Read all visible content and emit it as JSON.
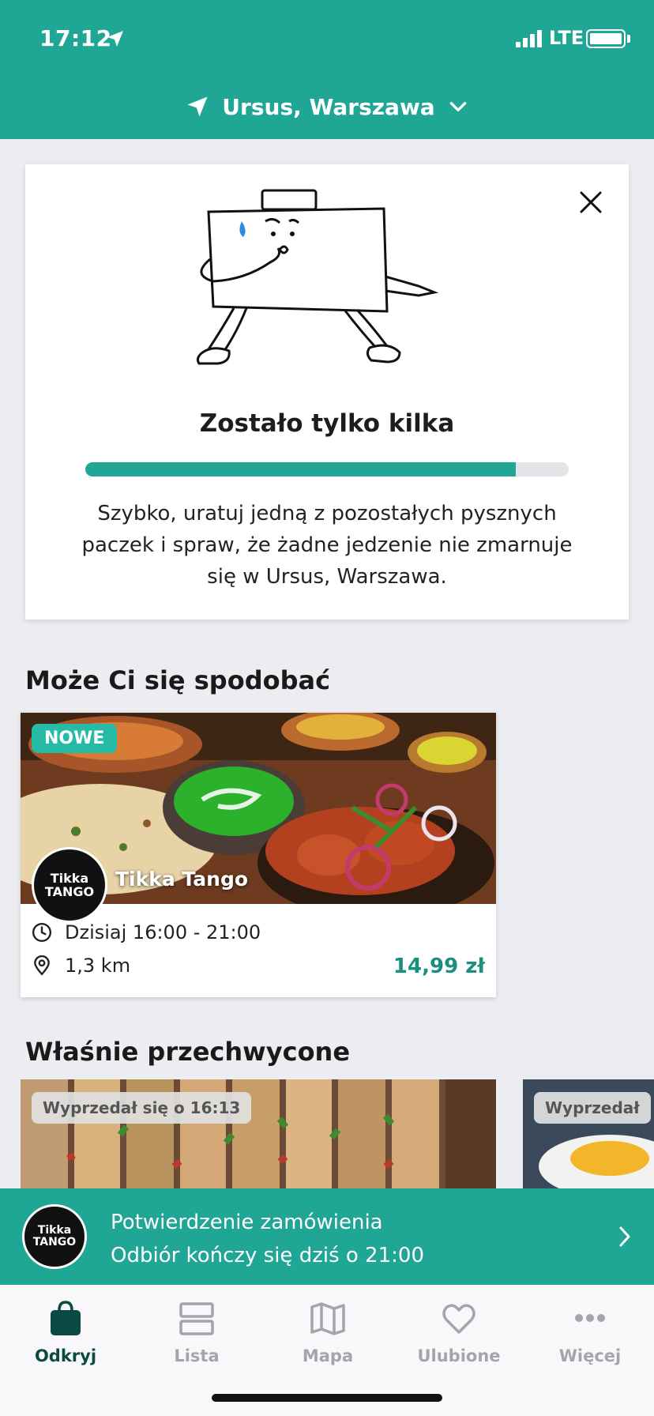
{
  "status_bar": {
    "time": "17:12",
    "network": "LTE"
  },
  "location": {
    "label": "Ursus, Warszawa"
  },
  "promo": {
    "title": "Zostało tylko kilka",
    "progress_percent": 89,
    "description": "Szybko, uratuj jedną z pozostałych pysznych paczek i spraw, że żadne jedzenie nie zmarnuje się w Ursus, Warszawa."
  },
  "recommended": {
    "title": "Może Ci się spodobać",
    "store": {
      "badge": "NOWE",
      "name": "Tikka Tango",
      "logo_text_1": "Tikka",
      "logo_text_2": "TANGO",
      "pickup": "Dzisiaj 16:00 - 21:00",
      "distance": "1,3 km",
      "price": "14,99 zł"
    }
  },
  "just_caught": {
    "title": "Właśnie przechwycone",
    "items": [
      {
        "badge": "Wyprzedał się o 16:13"
      },
      {
        "badge": "Wyprzedał"
      }
    ]
  },
  "order_banner": {
    "logo_text_1": "Tikka",
    "logo_text_2": "TANGO",
    "title": "Potwierdzenie zamówienia",
    "subtitle": "Odbiór kończy się dziś o 21:00"
  },
  "tabs": [
    {
      "label": "Odkryj",
      "icon": "bag-icon",
      "active": true
    },
    {
      "label": "Lista",
      "icon": "list-icon",
      "active": false
    },
    {
      "label": "Mapa",
      "icon": "map-icon",
      "active": false
    },
    {
      "label": "Ulubione",
      "icon": "heart-icon",
      "active": false
    },
    {
      "label": "Więcej",
      "icon": "more-icon",
      "active": false
    }
  ],
  "colors": {
    "brand": "#1fa695",
    "price": "#1a8f80",
    "tab_active": "#0b4a42"
  }
}
